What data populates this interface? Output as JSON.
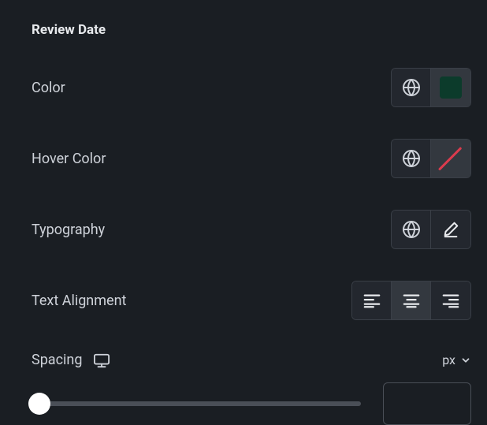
{
  "section": {
    "title": "Review Date"
  },
  "rows": {
    "color": {
      "label": "Color",
      "swatch": "#0c3b2b"
    },
    "hover_color": {
      "label": "Hover Color"
    },
    "typography": {
      "label": "Typography"
    },
    "alignment": {
      "label": "Text Alignment",
      "options": [
        "left",
        "center",
        "right"
      ],
      "selected": "center"
    },
    "spacing": {
      "label": "Spacing",
      "unit": "px",
      "value": ""
    }
  }
}
